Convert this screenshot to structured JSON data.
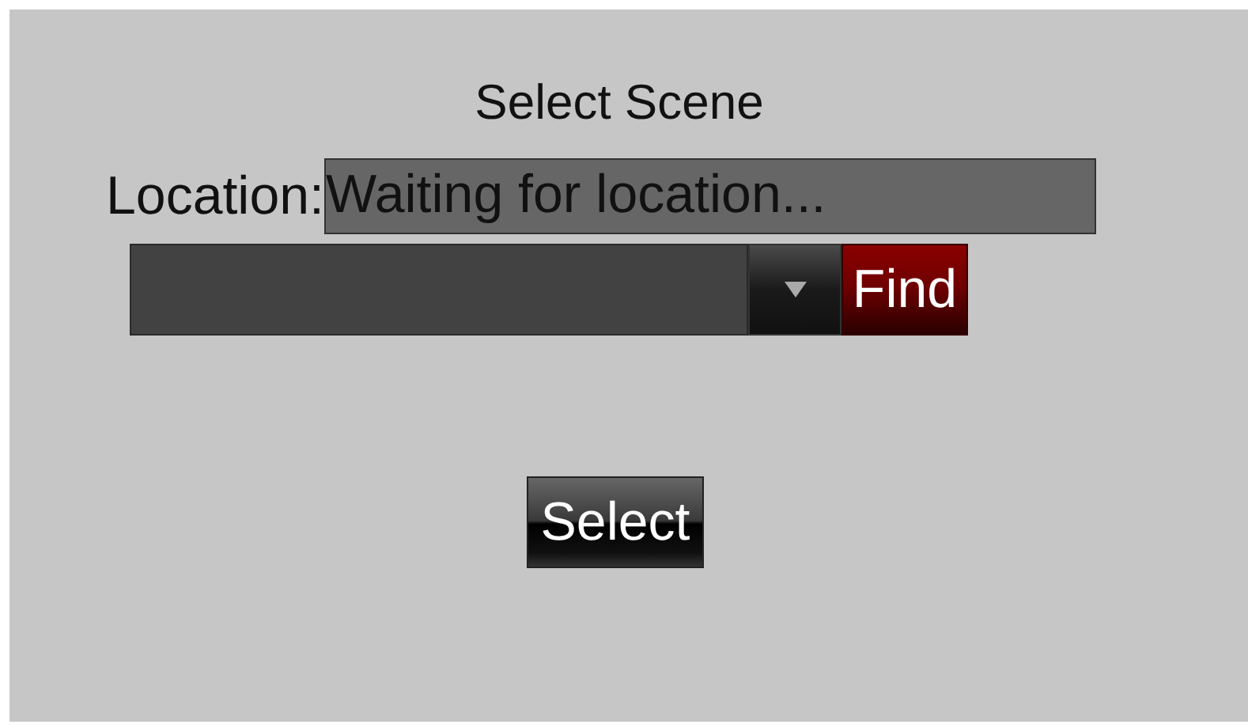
{
  "dialog": {
    "title": "Select Scene"
  },
  "location": {
    "label": "Location:",
    "value": "Waiting for location..."
  },
  "scene_picker": {
    "find_button": "Find"
  },
  "select_button": "Select"
}
